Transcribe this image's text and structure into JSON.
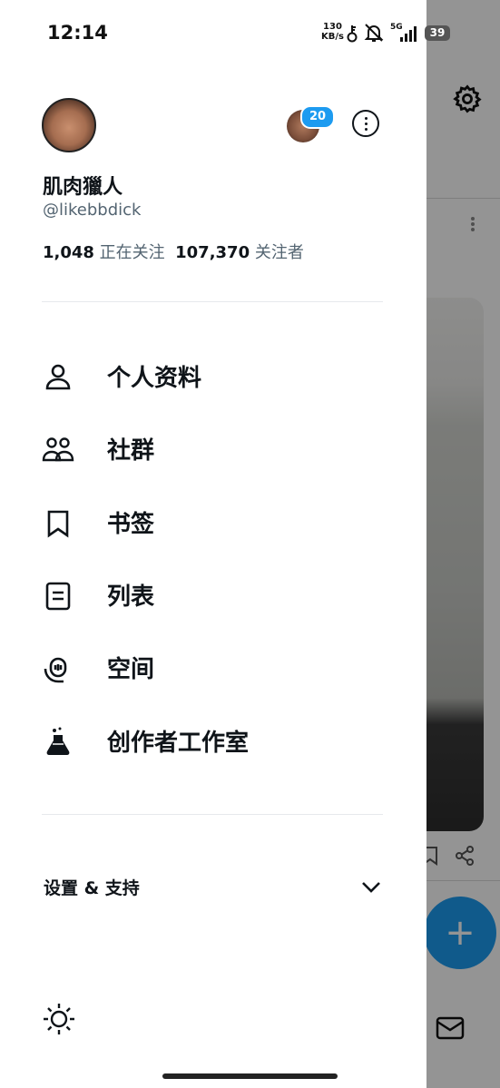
{
  "status_bar": {
    "time": "12:14",
    "speed_value": "130",
    "speed_unit": "KB/s",
    "network": "5G",
    "battery": "39"
  },
  "profile": {
    "display_name": "肌肉獵人",
    "handle": "@likebbdick",
    "following_count": "1,048",
    "following_label": "正在关注",
    "followers_count": "107,370",
    "followers_label": "关注者",
    "account_badge": "20"
  },
  "menu": {
    "items": [
      {
        "label": "个人资料",
        "icon": "person-icon"
      },
      {
        "label": "社群",
        "icon": "communities-icon"
      },
      {
        "label": "书签",
        "icon": "bookmark-icon"
      },
      {
        "label": "列表",
        "icon": "list-icon"
      },
      {
        "label": "空间",
        "icon": "spaces-icon"
      },
      {
        "label": "创作者工作室",
        "icon": "creator-studio-icon"
      }
    ]
  },
  "settings_support": {
    "label": "设置 & 支持",
    "expanded": false
  },
  "colors": {
    "accent": "#1d9bf0",
    "text_primary": "#0f1419",
    "text_secondary": "#536471",
    "divider": "#e6e9ec"
  }
}
